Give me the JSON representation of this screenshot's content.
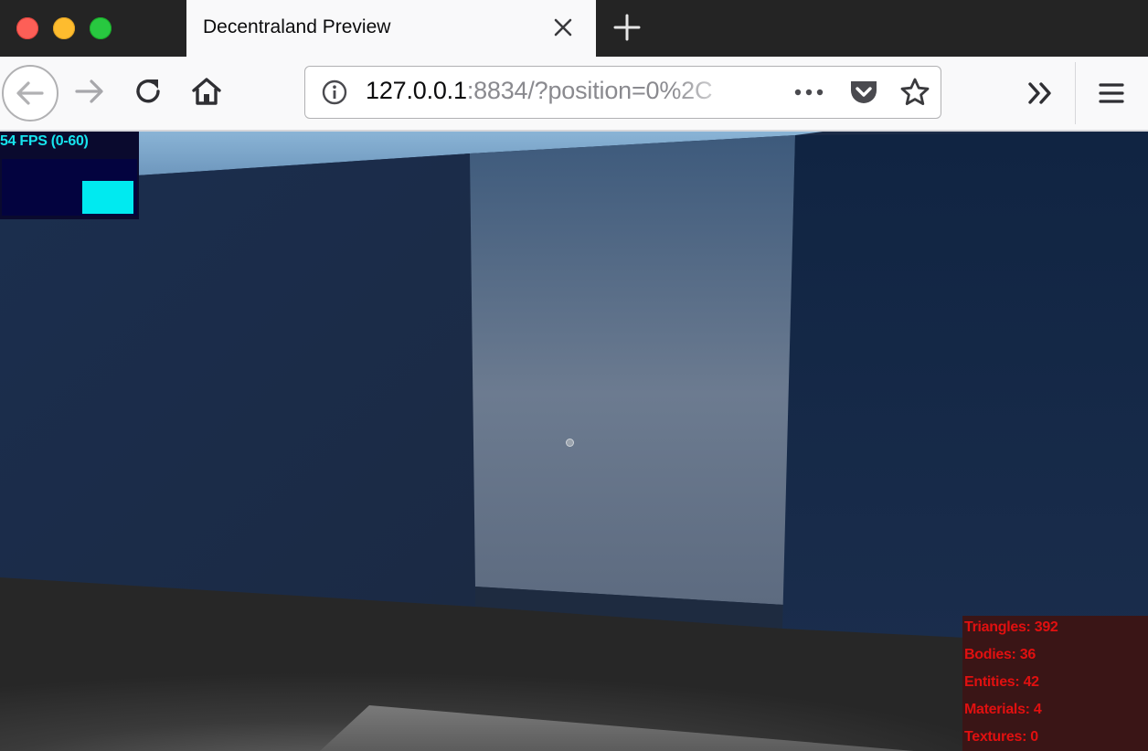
{
  "window": {
    "tab_title": "Decentraland Preview"
  },
  "toolbar": {
    "url_host": "127.0.0.1",
    "url_rest": ":8834/?position=0%2C"
  },
  "icons": {
    "close": "close-icon",
    "new_tab": "plus-icon",
    "back": "arrow-left-icon",
    "forward": "arrow-right-icon",
    "reload": "reload-icon",
    "home": "home-icon",
    "info": "info-icon",
    "page_actions": "ellipsis-icon",
    "pocket": "pocket-icon",
    "bookmark": "star-icon",
    "overflow": "double-chevron-icon",
    "menu": "hamburger-icon"
  },
  "colors": {
    "traffic_close": "#fd5f57",
    "traffic_minimize": "#febc2e",
    "traffic_maximize": "#28c840",
    "fps_text": "#17e3ee",
    "stats_text": "#e01010"
  },
  "overlay": {
    "fps": "54 FPS (0-60)",
    "stats": {
      "triangles": "Triangles: 392",
      "bodies": "Bodies: 36",
      "entities": "Entities: 42",
      "materials": "Materials: 4",
      "textures": "Textures: 0"
    }
  }
}
